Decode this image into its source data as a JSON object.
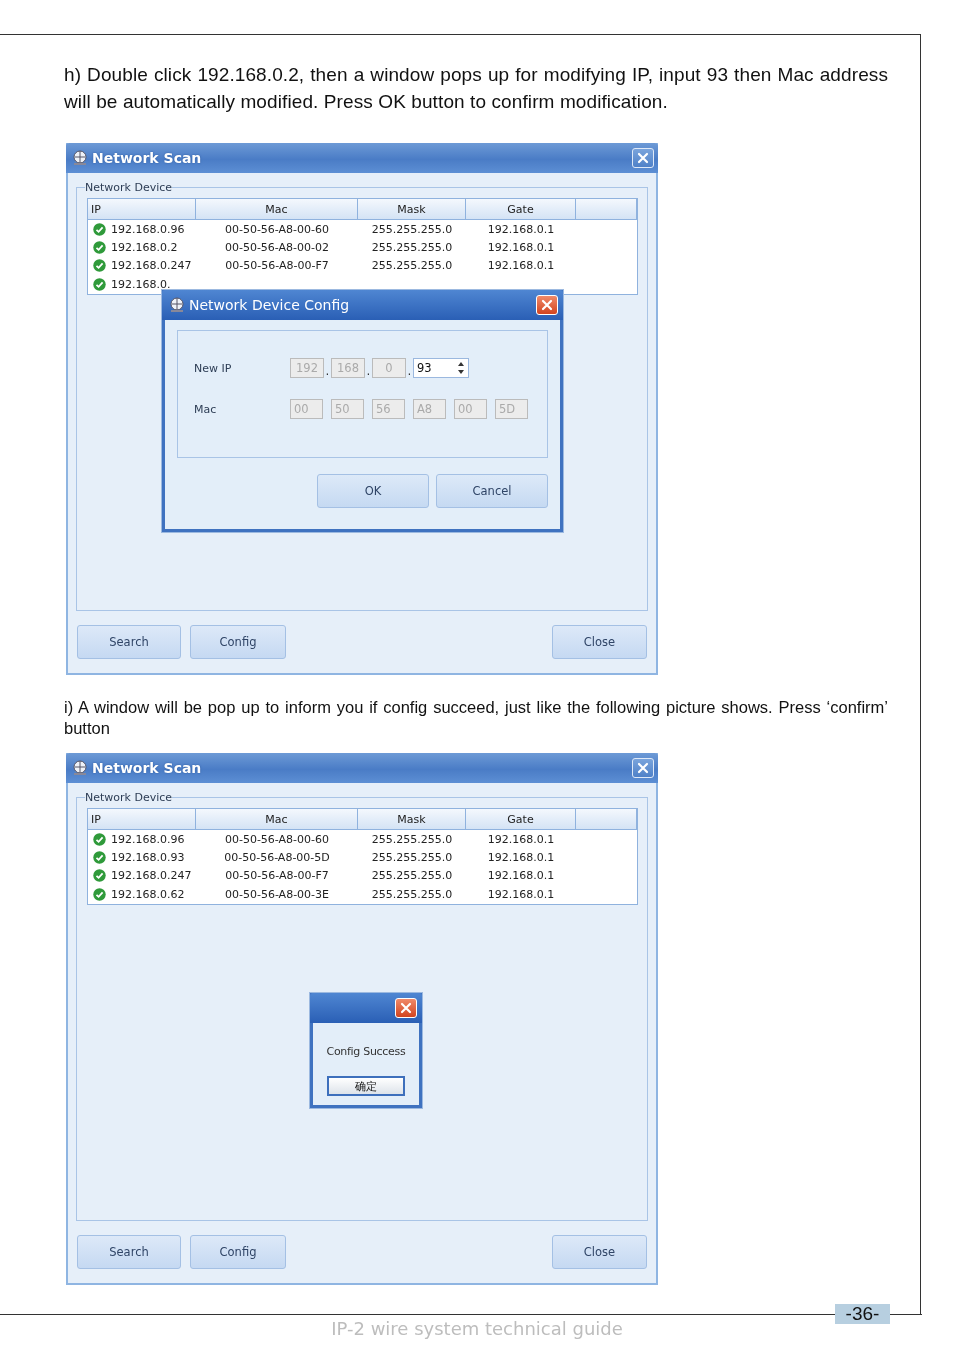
{
  "steps": [
    {
      "text": "h)  Double click 192.168.0.2, then a window pops up for modifying IP, input 93 then Mac address will be automatically modified. Press OK button to confirm modification.",
      "window": {
        "title": "Network Scan",
        "group_label": "Network Device",
        "columns": [
          "IP",
          "Mac",
          "Mask",
          "Gate"
        ],
        "rows": [
          {
            "ip": "192.168.0.96",
            "mac": "00-50-56-A8-00-60",
            "mask": "255.255.255.0",
            "gate": "192.168.0.1"
          },
          {
            "ip": "192.168.0.2",
            "mac": "00-50-56-A8-00-02",
            "mask": "255.255.255.0",
            "gate": "192.168.0.1"
          },
          {
            "ip": "192.168.0.247",
            "mac": "00-50-56-A8-00-F7",
            "mask": "255.255.255.0",
            "gate": "192.168.0.1"
          },
          {
            "ip": "192.168.0."
          }
        ],
        "buttons": [
          "Search",
          "Config",
          "Close"
        ],
        "dialog": {
          "kind": "config",
          "title": "Network Device Config",
          "ip_label": "New IP",
          "ip_separators": [
            ".",
            ".",
            "."
          ],
          "ip_octets": [
            {
              "value": "192",
              "disabled": true
            },
            {
              "value": "168",
              "disabled": true
            },
            {
              "value": "0",
              "disabled": true
            },
            {
              "value": "93",
              "disabled": false
            }
          ],
          "mac_label": "Mac",
          "mac_parts": [
            {
              "value": "00",
              "disabled": true
            },
            {
              "value": "50",
              "disabled": true
            },
            {
              "value": "56",
              "disabled": true
            },
            {
              "value": "A8",
              "disabled": true
            },
            {
              "value": "00",
              "disabled": true
            },
            {
              "value": "5D",
              "disabled": true
            }
          ],
          "buttons": [
            "OK",
            "Cancel"
          ]
        }
      }
    },
    {
      "text": "i)  A window will be pop up to inform you if config succeed, just like the following picture shows. Press ‘confirm’ button",
      "window": {
        "title": "Network Scan",
        "group_label": "Network Device",
        "columns": [
          "IP",
          "Mac",
          "Mask",
          "Gate"
        ],
        "rows": [
          {
            "ip": "192.168.0.96",
            "mac": "00-50-56-A8-00-60",
            "mask": "255.255.255.0",
            "gate": "192.168.0.1"
          },
          {
            "ip": "192.168.0.93",
            "mac": "00-50-56-A8-00-5D",
            "mask": "255.255.255.0",
            "gate": "192.168.0.1"
          },
          {
            "ip": "192.168.0.247",
            "mac": "00-50-56-A8-00-F7",
            "mask": "255.255.255.0",
            "gate": "192.168.0.1"
          },
          {
            "ip": "192.168.0.62",
            "mac": "00-50-56-A8-00-3E",
            "mask": "255.255.255.0",
            "gate": "192.168.0.1"
          }
        ],
        "buttons": [
          "Search",
          "Config",
          "Close"
        ],
        "dialog": {
          "kind": "message",
          "message": "Config Success",
          "button": "确定"
        }
      }
    }
  ],
  "footer": {
    "title": "IP-2 wire system technical guide",
    "page_number": "-36-"
  }
}
